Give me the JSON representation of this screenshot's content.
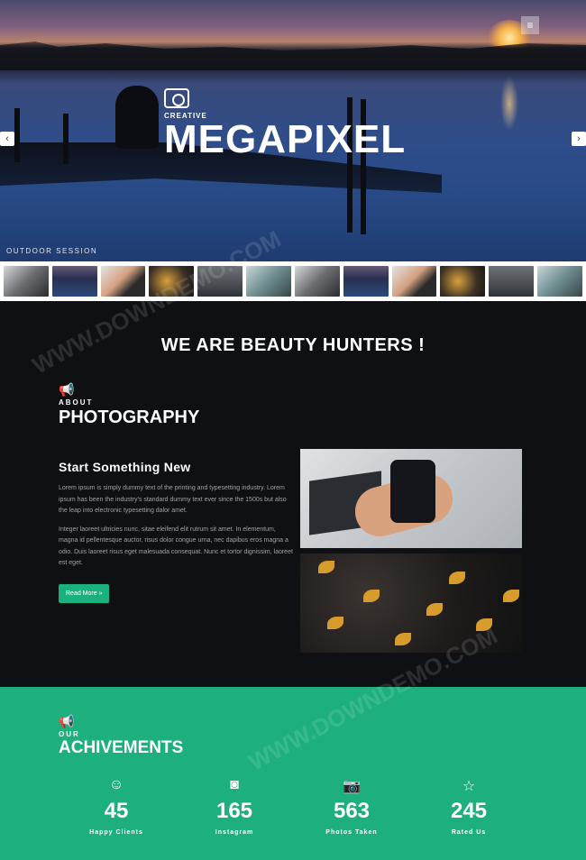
{
  "hero": {
    "brand_sub": "CREATIVE",
    "brand_title": "MEGAPIXEL",
    "caption": "OUTDOOR SESSION",
    "menu_icon": "menu-icon",
    "prev_icon": "chevron-left-icon",
    "next_icon": "chevron-right-icon"
  },
  "thumbnails": [
    {
      "alt": "camera lens"
    },
    {
      "alt": "sunset dock"
    },
    {
      "alt": "lens hand"
    },
    {
      "alt": "autumn leaves"
    },
    {
      "alt": "landscape"
    },
    {
      "alt": "people"
    },
    {
      "alt": "camera lens"
    },
    {
      "alt": "sunset dock"
    },
    {
      "alt": "lens hand"
    },
    {
      "alt": "autumn leaves"
    },
    {
      "alt": "landscape"
    },
    {
      "alt": "people"
    }
  ],
  "about": {
    "heading": "WE ARE BEAUTY HUNTERS !",
    "kicker": "ABOUT",
    "title": "PHOTOGRAPHY",
    "subtitle": "Start Something New",
    "para1": "Lorem ipsum is simply dummy text of the printing and typesetting industry. Lorem ipsum has been the industry's standard dummy text ever since the 1500s but also the leap into electronic typesetting dalor amet.",
    "para2": "Integer laoreet ultricies nunc, sitae eleifend elit rutrum sit amet. In elementum, magna id pellentesque auctor, risus dolor congue urna, nec dapibus eros magna a odio. Duis laoreet risus eget malesuada consequat. Nunc et tortor dignissim, laoreet est eget.",
    "read_more": "Read More »"
  },
  "achievements": {
    "kicker": "OUR",
    "title": "ACHIVEMENTS",
    "stats": [
      {
        "icon": "smile-icon",
        "value": "45",
        "label": "Happy Clients"
      },
      {
        "icon": "instagram-icon",
        "value": "165",
        "label": "Instagram"
      },
      {
        "icon": "camera-icon",
        "value": "563",
        "label": "Photos Taken"
      },
      {
        "icon": "star-icon",
        "value": "245",
        "label": "Rated Us"
      }
    ]
  },
  "watermark": "WWW.DOWNDEMO.COM"
}
